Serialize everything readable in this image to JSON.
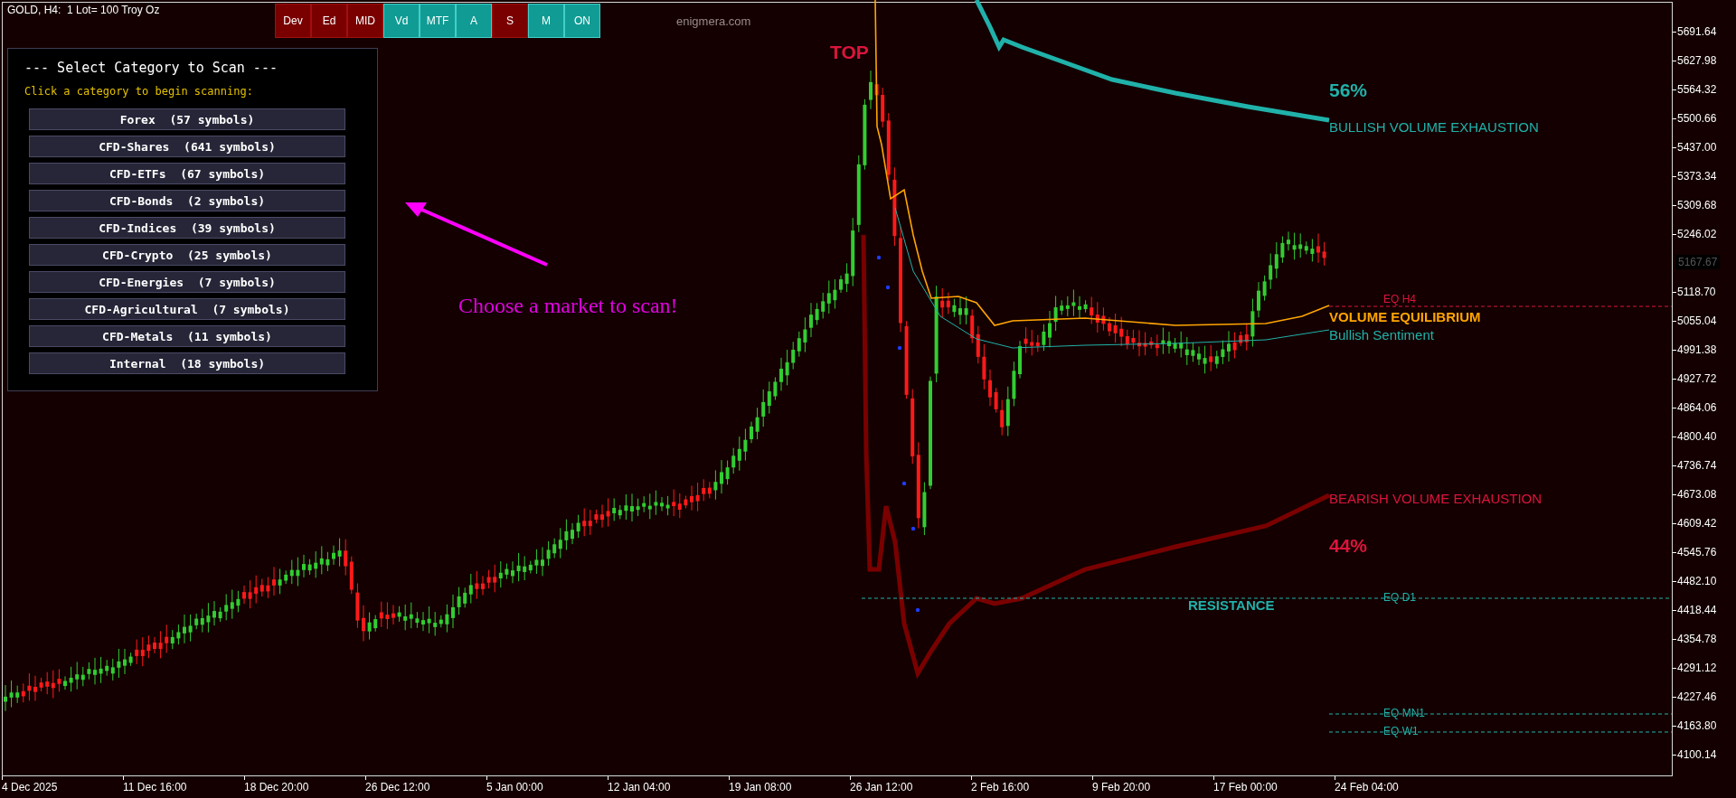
{
  "chart_header": {
    "symbol_info": "GOLD, H4:  1 Lot= 100 Troy Oz"
  },
  "toolbar": [
    {
      "label": "Dev",
      "on": false
    },
    {
      "label": "Ed",
      "on": false
    },
    {
      "label": "MID",
      "on": false
    },
    {
      "label": "Vd",
      "on": true
    },
    {
      "label": "MTF",
      "on": true
    },
    {
      "label": "A",
      "on": true
    },
    {
      "label": "S",
      "on": false
    },
    {
      "label": "M",
      "on": true
    },
    {
      "label": "ON",
      "on": true
    }
  ],
  "site_label": "enigmera.com",
  "scanner_panel": {
    "title": "--- Select Category to Scan ---",
    "instruction": "Click a category to begin scanning:",
    "categories": [
      "Forex  (57 symbols)",
      "CFD-Shares  (641 symbols)",
      "CFD-ETFs  (67 symbols)",
      "CFD-Bonds  (2 symbols)",
      "CFD-Indices  (39 symbols)",
      "CFD-Crypto  (25 symbols)",
      "CFD-Energies  (7 symbols)",
      "CFD-Agricultural  (7 symbols)",
      "CFD-Metals  (11 symbols)",
      "Internal  (18 symbols)"
    ]
  },
  "annotation": {
    "text": "Choose a market to scan!"
  },
  "chart_labels": [
    {
      "kind": "big",
      "text": "TOP",
      "color": "#dc143c"
    },
    {
      "kind": "big",
      "text": "56%",
      "color": "#20b2aa"
    },
    {
      "kind": "plain",
      "text": "BULLISH VOLUME EXHAUSTION",
      "color": "#20b2aa"
    },
    {
      "kind": "bold",
      "text": "VOLUME EQUILIBRIUM",
      "color": "#ffa500"
    },
    {
      "kind": "plain",
      "text": "Bullish Sentiment",
      "color": "#20b2aa"
    },
    {
      "kind": "plain",
      "text": "BEARISH VOLUME EXHAUSTION",
      "color": "#dc143c"
    },
    {
      "kind": "big",
      "text": "44%",
      "color": "#dc143c"
    },
    {
      "kind": "bold",
      "text": "RESISTANCE",
      "color": "#20b2aa"
    }
  ],
  "levels": [
    {
      "label": "EQ H4",
      "color": "#dc143c"
    },
    {
      "label": "EQ D1",
      "color": "#20b2aa"
    },
    {
      "label": "EQ MN1",
      "color": "#20b2aa"
    },
    {
      "label": "EQ W1",
      "color": "#20b2aa"
    }
  ],
  "price_axis": {
    "labels": [
      "5691.64",
      "5627.98",
      "5564.32",
      "5500.66",
      "5437.00",
      "5373.34",
      "5309.68",
      "5246.02",
      "5118.70",
      "5055.04",
      "4991.38",
      "4927.72",
      "4864.06",
      "4800.40",
      "4736.74",
      "4673.08",
      "4609.42",
      "4545.76",
      "4482.10",
      "4418.44",
      "4354.78",
      "4291.12",
      "4227.46",
      "4163.80",
      "4100.14"
    ],
    "current_price": "5167.67"
  },
  "time_axis": {
    "labels": [
      "4 Dec 2025",
      "11 Dec 16:00",
      "18 Dec 20:00",
      "26 Dec 12:00",
      "5 Jan 00:00",
      "12 Jan 04:00",
      "19 Jan 08:00",
      "26 Jan 12:00",
      "2 Feb 16:00",
      "9 Feb 20:00",
      "17 Feb 00:00",
      "24 Feb 04:00"
    ]
  }
}
